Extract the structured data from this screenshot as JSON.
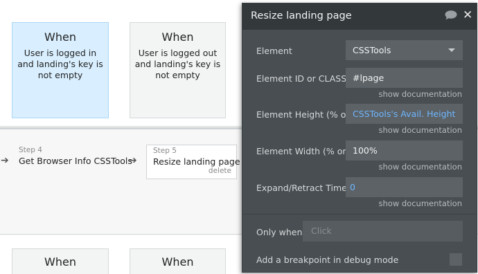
{
  "events_top": [
    {
      "title": "When",
      "condition": "User is logged in and landing's key is not empty",
      "active": true
    },
    {
      "title": "When",
      "condition": "User is logged out and landing's key is not empty",
      "active": false
    }
  ],
  "steps": [
    {
      "number": "Step 4",
      "name": "Get Browser Info CSSTools"
    },
    {
      "number": "Step 5",
      "name": "Resize landing page",
      "delete_label": "delete"
    }
  ],
  "events_bottom": [
    {
      "title": "When"
    },
    {
      "title": "When"
    }
  ],
  "panel": {
    "title": "Resize landing page",
    "properties": {
      "element": {
        "label": "Element",
        "value": "CSSTools"
      },
      "element_id": {
        "label": "Element ID or CLASS -",
        "value": "#lpage",
        "doc_link": "show documentation"
      },
      "element_height": {
        "label": "Element Height (% or",
        "value": "CSSTools's Avail. Height",
        "doc_link": "show documentation"
      },
      "element_width": {
        "label": "Element Width (% or p",
        "value": "100%",
        "doc_link": "show documentation"
      },
      "expand_time": {
        "label": "Expand/Retract Time",
        "value": "0",
        "doc_link": "show documentation"
      }
    },
    "only_when": {
      "label": "Only when",
      "placeholder": "Click"
    },
    "debug": {
      "label": "Add a breakpoint in debug mode"
    }
  },
  "colors": {
    "panel_bg": "#484e52",
    "panel_header": "#33383b",
    "dynamic_text": "#6fb6ff",
    "active_event": "#d9efff"
  },
  "icons": [
    "comment-icon",
    "close-icon",
    "chevron-down-icon",
    "arrow-right-icon"
  ]
}
